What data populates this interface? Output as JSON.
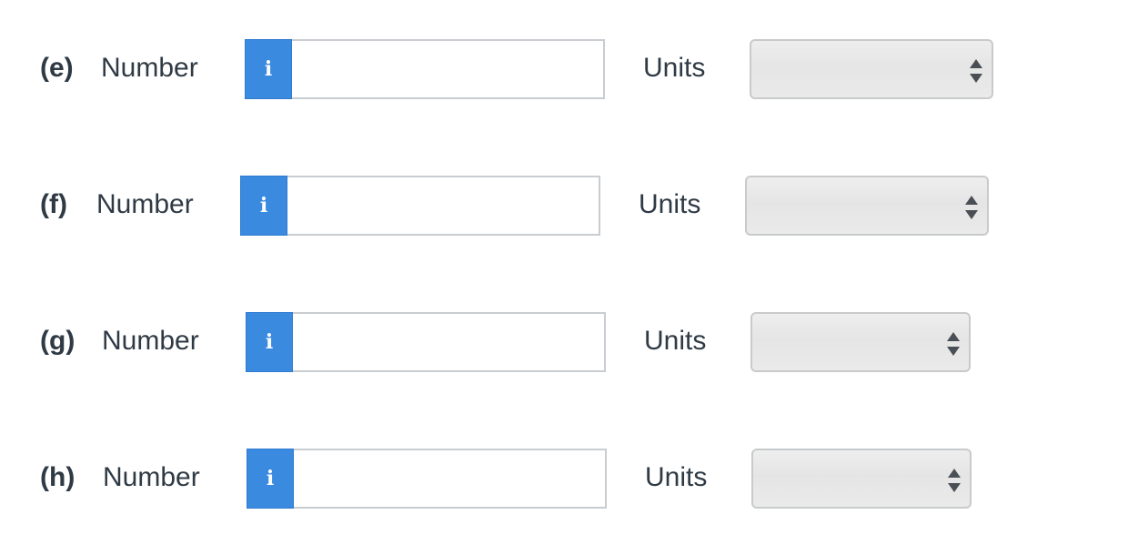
{
  "rows": [
    {
      "label": "(e)",
      "number_label": "Number",
      "info_glyph": "i",
      "value": "",
      "units_label": "Units",
      "units_selected": ""
    },
    {
      "label": "(f)",
      "number_label": "Number",
      "info_glyph": "i",
      "value": "",
      "units_label": "Units",
      "units_selected": ""
    },
    {
      "label": "(g)",
      "number_label": "Number",
      "info_glyph": "i",
      "value": "",
      "units_label": "Units",
      "units_selected": ""
    },
    {
      "label": "(h)",
      "number_label": "Number",
      "info_glyph": "i",
      "value": "",
      "units_label": "Units",
      "units_selected": ""
    }
  ],
  "colors": {
    "info_button": "#3a8ae0",
    "text": "#2f3a45",
    "field_border": "#c9cdd1"
  },
  "icons": {
    "info": "info-icon",
    "select_arrows": "up-down-arrows-icon"
  }
}
